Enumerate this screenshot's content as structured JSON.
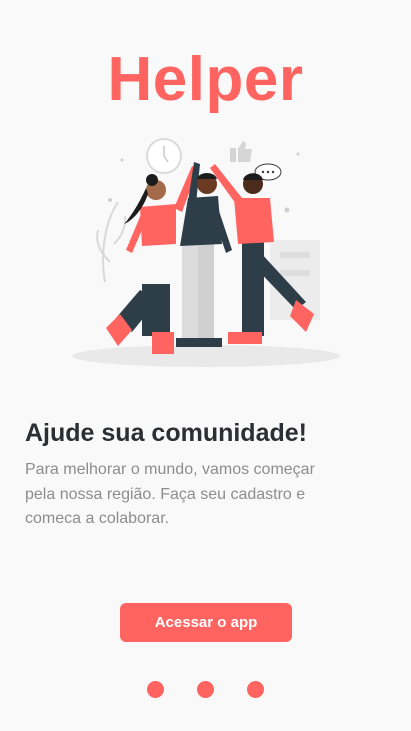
{
  "app": {
    "logo_text": "Helper"
  },
  "onboarding": {
    "title": "Ajude sua comunidade!",
    "description": "Para melhorar o mundo, vamos começar pela nossa região. Faça seu cadastro e comeca a colaborar.",
    "illustration_icon": "team-high-five-illustration",
    "cta_label": "Acessar o app"
  },
  "pagination": {
    "page_count": 3
  },
  "colors": {
    "accent": "#ff6461",
    "title_text": "#2b2f33",
    "body_text": "#8d8d8d",
    "background": "#f9f9f9"
  }
}
